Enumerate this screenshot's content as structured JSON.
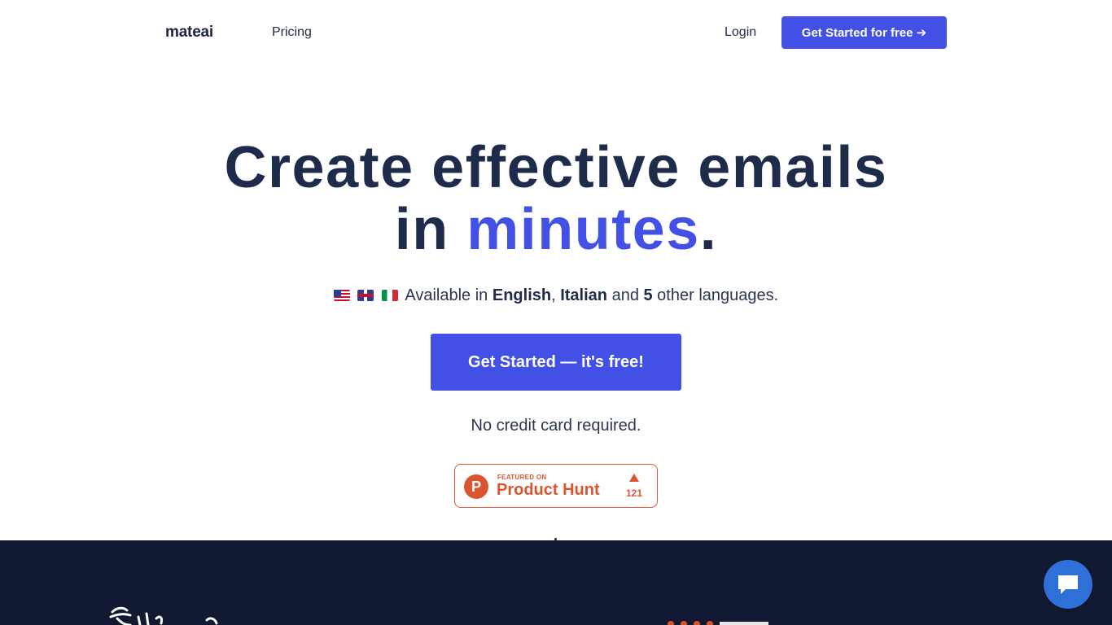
{
  "nav": {
    "logo": "mateai",
    "pricing": "Pricing",
    "login": "Login",
    "cta": "Get Started for free ➔"
  },
  "hero": {
    "title_line1": "Create effective emails",
    "title_line2_prefix": "in ",
    "title_line2_accent": "minutes",
    "title_line2_suffix": ".",
    "lang_prefix": "Available in ",
    "lang_1": "English",
    "lang_sep": ", ",
    "lang_2": "Italian",
    "lang_and": " and ",
    "lang_count": "5",
    "lang_suffix": " other languages.",
    "cta": "Get Started — it's free!",
    "note": "No credit card required."
  },
  "product_hunt": {
    "small": "FEATURED ON",
    "big": "Product Hunt",
    "logo_letter": "P",
    "count": "121"
  },
  "colors": {
    "accent": "#4350e6",
    "heading": "#1e2b4a",
    "dark_band": "#121a33",
    "product_hunt": "#da552f",
    "chat": "#2f6fd8"
  },
  "icons": {
    "flags": [
      "flag-us-icon",
      "flag-uk-icon",
      "flag-italy-icon"
    ],
    "chat": "chat-bubble-icon",
    "upvote": "upvote-triangle-icon"
  }
}
